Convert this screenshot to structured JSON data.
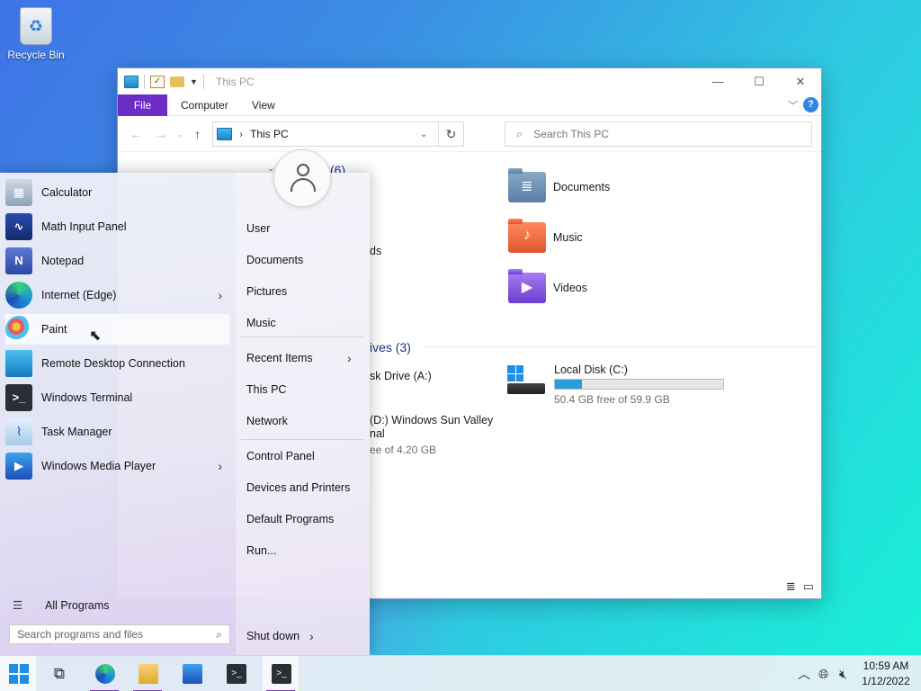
{
  "desktop": {
    "recycle_bin_label": "Recycle Bin"
  },
  "explorer": {
    "title": "This PC",
    "ribbon_tabs": [
      "File",
      "Computer",
      "View"
    ],
    "address": "This PC",
    "search_placeholder": "Search This PC",
    "folders_header_partial": "(6)",
    "folders": [
      {
        "name": "Documents",
        "icon": "documents-folder-icon"
      },
      {
        "name": "Music",
        "icon": "music-folder-icon"
      },
      {
        "name": "Videos",
        "icon": "videos-folder-icon"
      }
    ],
    "partial_folder_label": "ds",
    "drives_header_partial": "ives (3)",
    "drives": [
      {
        "name_partial": "sk Drive (A:)"
      },
      {
        "name": "Local Disk (C:)",
        "free_text": "50.4 GB free of 59.9 GB",
        "used_fraction": 0.16
      },
      {
        "name_partial_line1": "(D:) Windows Sun Valley",
        "name_partial_line2": "nal",
        "free_partial": "ee of 4.20 GB"
      }
    ]
  },
  "start_menu": {
    "programs": [
      {
        "label": "Calculator",
        "icon": "calculator-icon",
        "submenu": false
      },
      {
        "label": "Math Input Panel",
        "icon": "math-input-icon",
        "submenu": false
      },
      {
        "label": "Notepad",
        "icon": "notepad-icon",
        "submenu": false
      },
      {
        "label": "Internet (Edge)",
        "icon": "edge-icon",
        "submenu": true
      },
      {
        "label": "Paint",
        "icon": "paint-icon",
        "submenu": false
      },
      {
        "label": "Remote Desktop Connection",
        "icon": "remote-desktop-icon",
        "submenu": false
      },
      {
        "label": "Windows Terminal",
        "icon": "terminal-icon",
        "submenu": false
      },
      {
        "label": "Task Manager",
        "icon": "task-manager-icon",
        "submenu": false
      },
      {
        "label": "Windows Media Player",
        "icon": "media-player-icon",
        "submenu": true
      }
    ],
    "all_programs": "All Programs",
    "search_placeholder": "Search programs and files",
    "places": [
      "User",
      "Documents",
      "Pictures",
      "Music",
      "Recent Items",
      "This PC",
      "Network",
      "Control Panel",
      "Devices and Printers",
      "Default Programs",
      "Run..."
    ],
    "shutdown": "Shut down"
  },
  "taskbar": {
    "time": "10:59 AM",
    "date": "1/12/2022",
    "apps": [
      "start-icon",
      "task-view-icon",
      "edge-icon",
      "file-explorer-icon",
      "media-player-icon",
      "terminal-icon",
      "terminal-icon"
    ]
  },
  "colors": {
    "accent": "#6c2dc7",
    "link_blue": "#1e3287",
    "drive_bar": "#26a0da"
  }
}
